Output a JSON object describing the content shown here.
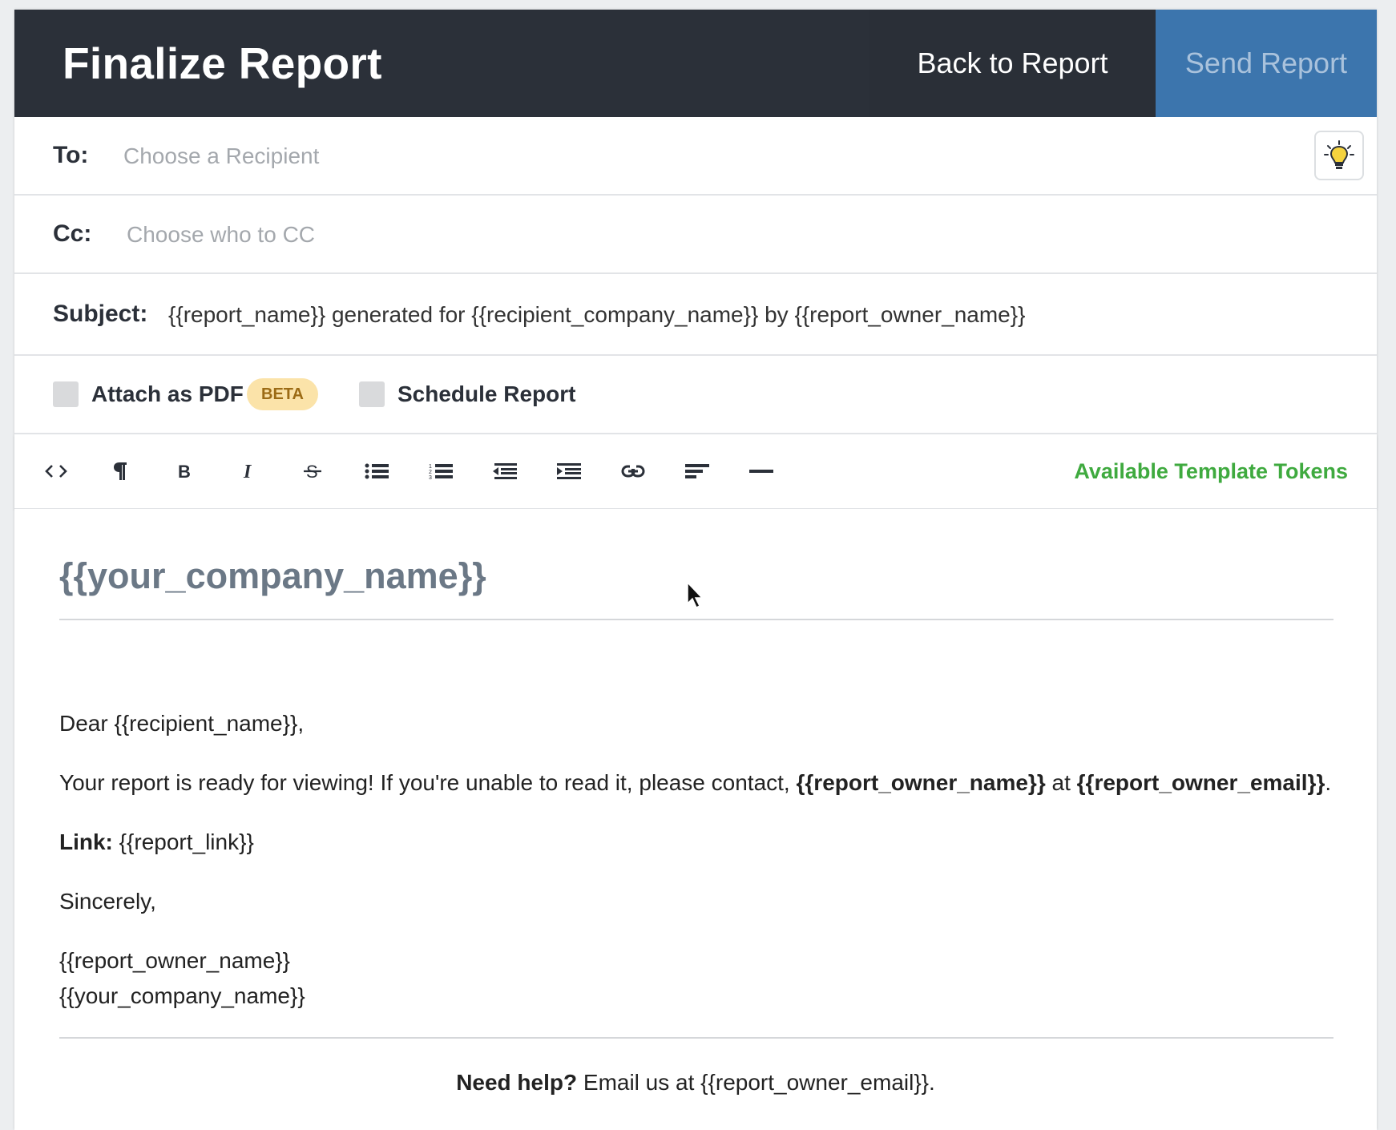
{
  "header": {
    "title": "Finalize Report",
    "back_label": "Back to Report",
    "send_label": "Send Report"
  },
  "to": {
    "label": "To:",
    "placeholder": "Choose a Recipient",
    "value": ""
  },
  "cc": {
    "label": "Cc:",
    "placeholder": "Choose who to CC",
    "value": ""
  },
  "subject": {
    "label": "Subject:",
    "value": "{{report_name}} generated for {{recipient_company_name}} by {{report_owner_name}}"
  },
  "options": {
    "attach_pdf_label": "Attach as PDF",
    "beta_badge": "BETA",
    "schedule_label": "Schedule Report",
    "attach_pdf_checked": false,
    "schedule_checked": false
  },
  "toolbar": {
    "buttons": [
      {
        "name": "html-code",
        "icon": "code-icon",
        "glyph": "<>"
      },
      {
        "name": "paragraph",
        "icon": "pilcrow-icon",
        "glyph": "¶"
      },
      {
        "name": "bold",
        "icon": "bold-icon",
        "glyph": "B"
      },
      {
        "name": "italic",
        "icon": "italic-icon",
        "glyph": "I"
      },
      {
        "name": "strikethrough",
        "icon": "strikethrough-icon",
        "glyph": "S"
      },
      {
        "name": "bullet-list",
        "icon": "unordered-list-icon"
      },
      {
        "name": "numbered-list",
        "icon": "ordered-list-icon"
      },
      {
        "name": "outdent",
        "icon": "outdent-icon"
      },
      {
        "name": "indent",
        "icon": "indent-icon"
      },
      {
        "name": "link",
        "icon": "link-icon"
      },
      {
        "name": "align",
        "icon": "align-left-icon"
      },
      {
        "name": "horizontal-rule",
        "icon": "horizontal-rule-icon"
      }
    ],
    "tokens_label": "Available Template Tokens",
    "tokens_color": "#3faa3f"
  },
  "body": {
    "heading": "{{your_company_name}}",
    "greeting": "Dear {{recipient_name}},",
    "line1_text": "Your report is ready for viewing! If you're unable to read it, please contact, ",
    "line1_owner": "{{report_owner_name}}",
    "line1_at": " at ",
    "line1_email": "{{report_owner_email}}",
    "line1_end": ".",
    "link_label": "Link:",
    "link_value": " {{report_link}}",
    "closing": "Sincerely,",
    "sig_name": "{{report_owner_name}}",
    "sig_company": "{{your_company_name}}",
    "help_bold": "Need help?",
    "help_text": " Email us at {{report_owner_email}}."
  },
  "colors": {
    "header_bg": "#2b3039",
    "send_bg": "#3c75ad",
    "beta_bg": "#fbe3a9"
  }
}
